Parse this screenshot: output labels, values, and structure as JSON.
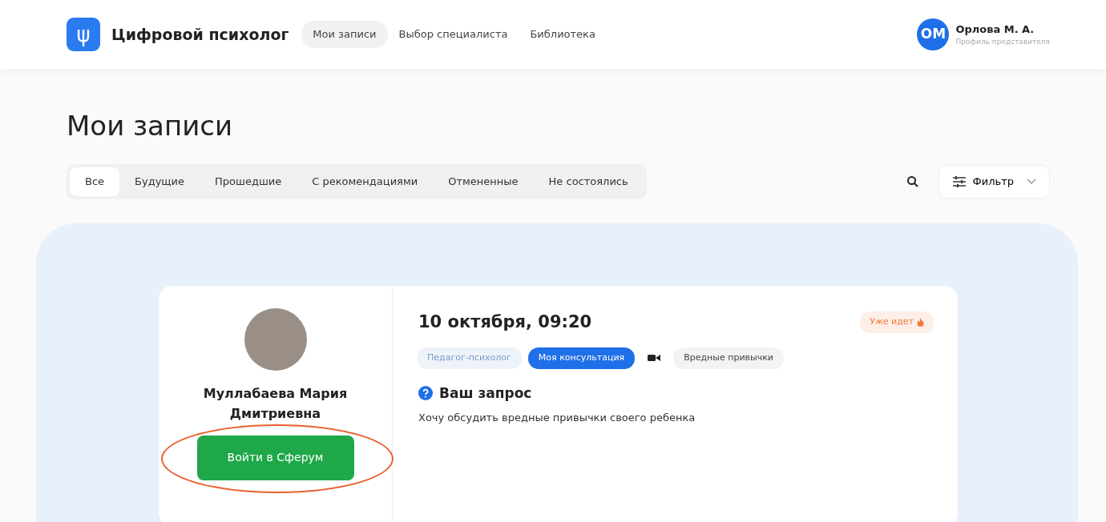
{
  "header": {
    "brand": "Цифровой психолог",
    "logo_glyph": "ψ",
    "nav": [
      {
        "label": "Мои записи",
        "selected": true
      },
      {
        "label": "Выбор специалиста",
        "selected": false
      },
      {
        "label": "Библиотека",
        "selected": false
      }
    ],
    "user": {
      "initials": "ОМ",
      "name": "Орлова М. А.",
      "role": "Профиль представителя"
    }
  },
  "page_title": "Мои записи",
  "filter_tabs": [
    {
      "label": "Все",
      "selected": true
    },
    {
      "label": "Будущие",
      "selected": false
    },
    {
      "label": "Прошедшие",
      "selected": false
    },
    {
      "label": "С рекомендациями",
      "selected": false
    },
    {
      "label": "Отмененные",
      "selected": false
    },
    {
      "label": "Не состоялись",
      "selected": false
    }
  ],
  "filter_button": {
    "label": "Фильтр"
  },
  "appointments": [
    {
      "specialist": "Муллабаева Мария Дмитриевна",
      "datetime": "10 октября, 09:20",
      "status": "Уже идет",
      "tags": [
        {
          "kind": "role",
          "label": "Педагог-психолог"
        },
        {
          "kind": "owner",
          "label": "Моя консультация"
        },
        {
          "kind": "video"
        },
        {
          "kind": "topic",
          "label": "Вредные привычки"
        }
      ],
      "request_title": "Ваш запрос",
      "request_text": "Хочу обсудить вредные привычки своего ребенка",
      "join_button": {
        "label": "Войти в Сферум",
        "circled": true
      }
    }
  ]
}
